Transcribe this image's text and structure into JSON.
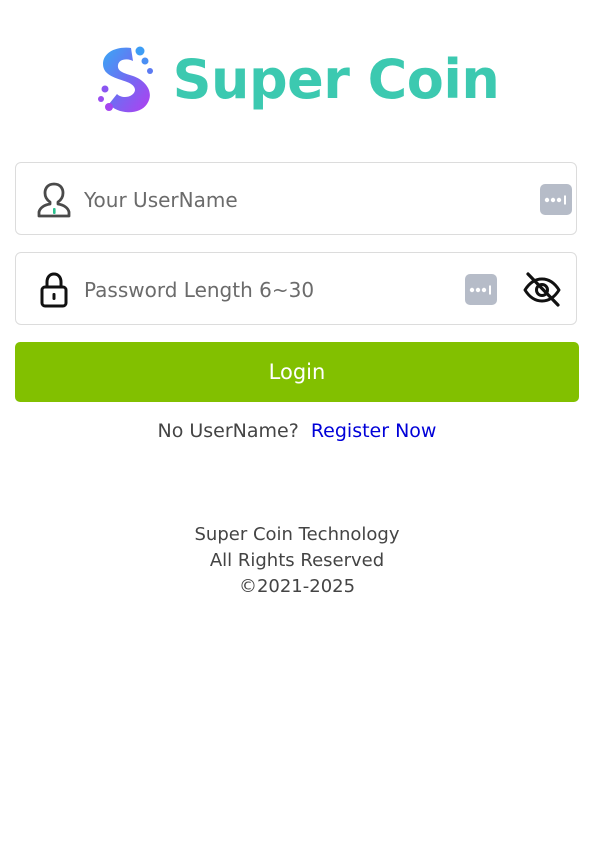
{
  "brand": {
    "title": "Super Coin",
    "logo_icon": "super-coin-s-logo"
  },
  "colors": {
    "brand_teal": "#3cc9b0",
    "login_green": "#82c000",
    "link_blue": "#0000d8",
    "field_border": "#dcdcdc",
    "password_key_gray": "#b6bcc8"
  },
  "form": {
    "username": {
      "placeholder": "Your UserName",
      "value": "",
      "icon": "user-icon",
      "autofill_icon": "password-key-icon"
    },
    "password": {
      "placeholder": "Password Length 6~30",
      "value": "",
      "icon": "lock-icon",
      "autofill_icon": "password-key-icon",
      "visibility_icon": "eye-slash-icon"
    },
    "login_label": "Login"
  },
  "register": {
    "question": "No UserName?",
    "link_label": "Register Now"
  },
  "footer": {
    "line1": "Super Coin Technology",
    "line2": "All Rights Reserved",
    "line3": "©2021-2025"
  }
}
